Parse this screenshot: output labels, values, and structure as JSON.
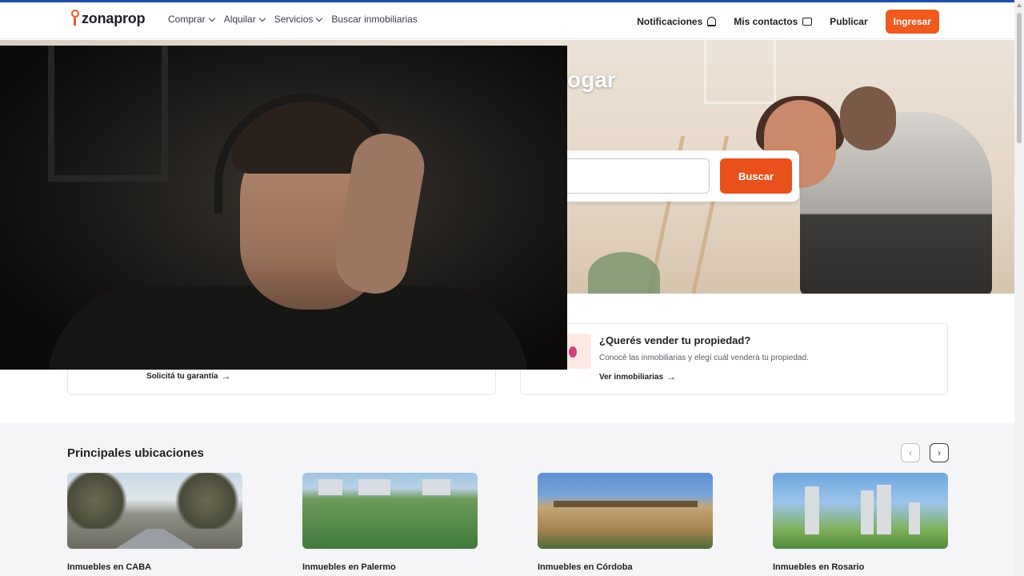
{
  "header": {
    "logo_text": "zonaprop",
    "nav": [
      {
        "label": "Comprar",
        "has_dropdown": true
      },
      {
        "label": "Alquilar",
        "has_dropdown": true
      },
      {
        "label": "Servicios",
        "has_dropdown": true
      },
      {
        "label": "Buscar inmobiliarias",
        "has_dropdown": false
      }
    ],
    "notifications_label": "Notificaciones",
    "contacts_label": "Mis contactos",
    "publish_label": "Publicar",
    "login_label": "Ingresar"
  },
  "hero": {
    "title_visible_fragment": "ogar",
    "search_placeholder": "",
    "search_button": "Buscar"
  },
  "cards": {
    "left_link": "Solicitá tu garantía",
    "right_title": "¿Querés vender tu propiedad?",
    "right_desc": "Conocé las inmobiliarias y elegí cuál venderá tu propiedad.",
    "right_link": "Ver inmobiliarias"
  },
  "locations": {
    "title": "Principales ubicaciones",
    "prev_icon": "‹",
    "next_icon": "›",
    "items": [
      {
        "label": "Inmuebles en CABA"
      },
      {
        "label": "Inmuebles en Palermo"
      },
      {
        "label": "Inmuebles en Córdoba"
      },
      {
        "label": "Inmuebles en Rosario"
      }
    ]
  },
  "colors": {
    "brand_orange": "#ef5a1d",
    "top_line": "#1f4fa8",
    "text_dark": "#1f1f24"
  },
  "icons": {
    "bell": "bell-icon",
    "chat": "chat-icon",
    "arrow": "→"
  }
}
